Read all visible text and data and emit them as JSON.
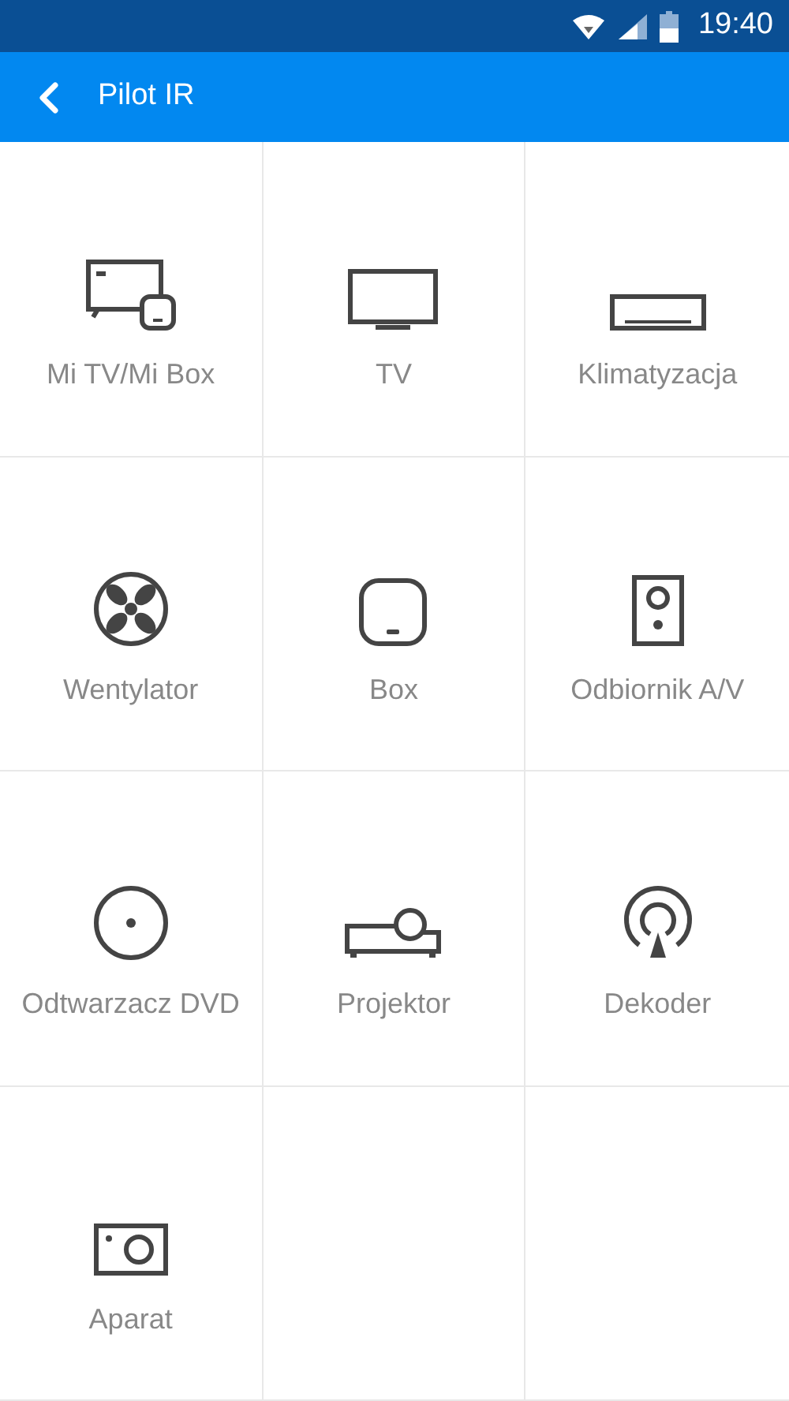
{
  "status_bar": {
    "time": "19:40"
  },
  "header": {
    "title": "Pilot IR"
  },
  "devices": [
    {
      "kind": "mitv",
      "label": "Mi TV/Mi Box"
    },
    {
      "kind": "tv",
      "label": "TV"
    },
    {
      "kind": "ac",
      "label": "Klimatyzacja"
    },
    {
      "kind": "fan",
      "label": "Wentylator"
    },
    {
      "kind": "box",
      "label": "Box"
    },
    {
      "kind": "speaker",
      "label": "Odbiornik A/V"
    },
    {
      "kind": "dvd",
      "label": "Odtwarzacz DVD"
    },
    {
      "kind": "projector",
      "label": "Projektor"
    },
    {
      "kind": "decoder",
      "label": "Dekoder"
    },
    {
      "kind": "camera",
      "label": "Aparat"
    }
  ]
}
